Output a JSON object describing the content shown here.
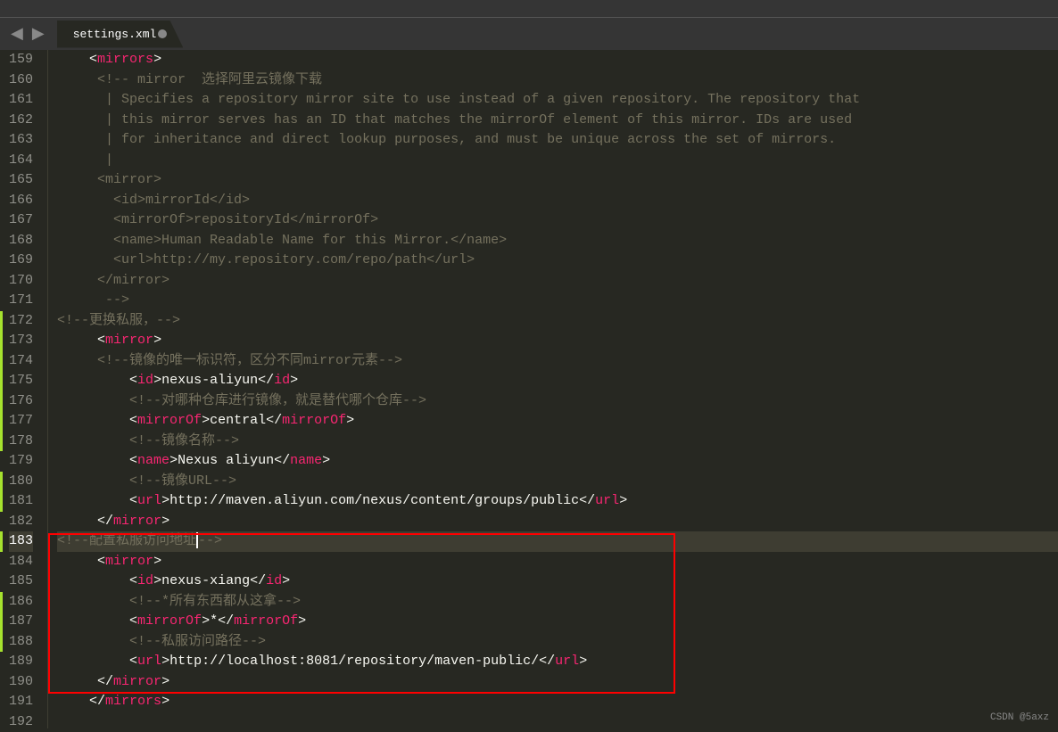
{
  "tab": {
    "label": "settings.xml"
  },
  "watermark": "CSDN @5axz",
  "lines": [
    {
      "n": 159,
      "indent": "    ",
      "parts": [
        {
          "t": "<",
          "c": "punct"
        },
        {
          "t": "mirrors",
          "c": "tag"
        },
        {
          "t": ">",
          "c": "punct"
        }
      ]
    },
    {
      "n": 160,
      "indent": "     ",
      "parts": [
        {
          "t": "<!-- mirror  选择阿里云镜像下载",
          "c": "comment"
        }
      ]
    },
    {
      "n": 161,
      "indent": "      ",
      "parts": [
        {
          "t": "| Specifies a repository mirror site to use instead of a given repository. The repository that",
          "c": "comment"
        }
      ]
    },
    {
      "n": 162,
      "indent": "      ",
      "parts": [
        {
          "t": "| this mirror serves has an ID that matches the mirrorOf element of this mirror. IDs are used",
          "c": "comment"
        }
      ]
    },
    {
      "n": 163,
      "indent": "      ",
      "parts": [
        {
          "t": "| for inheritance and direct lookup purposes, and must be unique across the set of mirrors.",
          "c": "comment"
        }
      ]
    },
    {
      "n": 164,
      "indent": "      ",
      "parts": [
        {
          "t": "|",
          "c": "comment"
        }
      ]
    },
    {
      "n": 165,
      "indent": "     ",
      "parts": [
        {
          "t": "<mirror>",
          "c": "comment"
        }
      ]
    },
    {
      "n": 166,
      "indent": "       ",
      "parts": [
        {
          "t": "<id>mirrorId</id>",
          "c": "comment"
        }
      ]
    },
    {
      "n": 167,
      "indent": "       ",
      "parts": [
        {
          "t": "<mirrorOf>repositoryId</mirrorOf>",
          "c": "comment"
        }
      ]
    },
    {
      "n": 168,
      "indent": "       ",
      "parts": [
        {
          "t": "<name>Human Readable Name for this Mirror.</name>",
          "c": "comment"
        }
      ]
    },
    {
      "n": 169,
      "indent": "       ",
      "parts": [
        {
          "t": "<url>http://my.repository.com/repo/path</url>",
          "c": "comment"
        }
      ]
    },
    {
      "n": 170,
      "indent": "     ",
      "parts": [
        {
          "t": "</mirror>",
          "c": "comment"
        }
      ]
    },
    {
      "n": 171,
      "indent": "      ",
      "parts": [
        {
          "t": "-->",
          "c": "comment"
        }
      ]
    },
    {
      "n": 172,
      "indent": "",
      "parts": [
        {
          "t": "<!--更换私服，-->",
          "c": "comment"
        }
      ]
    },
    {
      "n": 173,
      "indent": "     ",
      "parts": [
        {
          "t": "<",
          "c": "punct"
        },
        {
          "t": "mirror",
          "c": "tag"
        },
        {
          "t": ">",
          "c": "punct"
        }
      ]
    },
    {
      "n": 174,
      "indent": "     ",
      "parts": [
        {
          "t": "<!--镜像的唯一标识符，区分不同mirror元素-->",
          "c": "comment"
        }
      ]
    },
    {
      "n": 175,
      "indent": "         ",
      "parts": [
        {
          "t": "<",
          "c": "punct"
        },
        {
          "t": "id",
          "c": "tag"
        },
        {
          "t": ">",
          "c": "punct"
        },
        {
          "t": "nexus-aliyun",
          "c": "text"
        },
        {
          "t": "</",
          "c": "punct"
        },
        {
          "t": "id",
          "c": "tag"
        },
        {
          "t": ">",
          "c": "punct"
        }
      ]
    },
    {
      "n": 176,
      "indent": "         ",
      "parts": [
        {
          "t": "<!--对哪种仓库进行镜像，就是替代哪个仓库-->",
          "c": "comment"
        }
      ]
    },
    {
      "n": 177,
      "indent": "         ",
      "parts": [
        {
          "t": "<",
          "c": "punct"
        },
        {
          "t": "mirrorOf",
          "c": "tag"
        },
        {
          "t": ">",
          "c": "punct"
        },
        {
          "t": "central",
          "c": "text"
        },
        {
          "t": "</",
          "c": "punct"
        },
        {
          "t": "mirrorOf",
          "c": "tag"
        },
        {
          "t": ">",
          "c": "punct"
        }
      ]
    },
    {
      "n": 178,
      "indent": "         ",
      "parts": [
        {
          "t": "<!--镜像名称-->",
          "c": "comment"
        }
      ]
    },
    {
      "n": 179,
      "indent": "         ",
      "parts": [
        {
          "t": "<",
          "c": "punct"
        },
        {
          "t": "name",
          "c": "tag"
        },
        {
          "t": ">",
          "c": "punct"
        },
        {
          "t": "Nexus aliyun",
          "c": "text"
        },
        {
          "t": "</",
          "c": "punct"
        },
        {
          "t": "name",
          "c": "tag"
        },
        {
          "t": ">",
          "c": "punct"
        }
      ]
    },
    {
      "n": 180,
      "indent": "         ",
      "parts": [
        {
          "t": "<!--镜像URL-->",
          "c": "comment"
        }
      ]
    },
    {
      "n": 181,
      "indent": "         ",
      "parts": [
        {
          "t": "<",
          "c": "punct"
        },
        {
          "t": "url",
          "c": "tag"
        },
        {
          "t": ">",
          "c": "punct"
        },
        {
          "t": "http://maven.aliyun.com/nexus/content/groups/public",
          "c": "text"
        },
        {
          "t": "</",
          "c": "punct"
        },
        {
          "t": "url",
          "c": "tag"
        },
        {
          "t": ">",
          "c": "punct"
        }
      ]
    },
    {
      "n": 182,
      "indent": "     ",
      "parts": [
        {
          "t": "</",
          "c": "punct"
        },
        {
          "t": "mirror",
          "c": "tag"
        },
        {
          "t": ">",
          "c": "punct"
        }
      ]
    },
    {
      "n": 183,
      "indent": "",
      "current": true,
      "parts": [
        {
          "t": "<!--配置私服访问地址",
          "c": "comment"
        },
        {
          "t": "CURSOR",
          "c": "cursor"
        },
        {
          "t": "-->",
          "c": "comment"
        }
      ]
    },
    {
      "n": 184,
      "indent": "     ",
      "parts": [
        {
          "t": "<",
          "c": "punct"
        },
        {
          "t": "mirror",
          "c": "tag"
        },
        {
          "t": ">",
          "c": "punct"
        }
      ]
    },
    {
      "n": 185,
      "indent": "         ",
      "parts": [
        {
          "t": "<",
          "c": "punct"
        },
        {
          "t": "id",
          "c": "tag"
        },
        {
          "t": ">",
          "c": "punct"
        },
        {
          "t": "nexus-xiang",
          "c": "text"
        },
        {
          "t": "</",
          "c": "punct"
        },
        {
          "t": "id",
          "c": "tag"
        },
        {
          "t": ">",
          "c": "punct"
        }
      ]
    },
    {
      "n": 186,
      "indent": "         ",
      "parts": [
        {
          "t": "<!--*所有东西都从这拿-->",
          "c": "comment"
        }
      ]
    },
    {
      "n": 187,
      "indent": "         ",
      "parts": [
        {
          "t": "<",
          "c": "punct"
        },
        {
          "t": "mirrorOf",
          "c": "tag"
        },
        {
          "t": ">",
          "c": "punct"
        },
        {
          "t": "*",
          "c": "text"
        },
        {
          "t": "</",
          "c": "punct"
        },
        {
          "t": "mirrorOf",
          "c": "tag"
        },
        {
          "t": ">",
          "c": "punct"
        }
      ]
    },
    {
      "n": 188,
      "indent": "         ",
      "parts": [
        {
          "t": "<!--私服访问路径-->",
          "c": "comment"
        }
      ]
    },
    {
      "n": 189,
      "indent": "         ",
      "parts": [
        {
          "t": "<",
          "c": "punct"
        },
        {
          "t": "url",
          "c": "tag"
        },
        {
          "t": ">",
          "c": "punct"
        },
        {
          "t": "http://localhost:8081/repository/maven-public/",
          "c": "text"
        },
        {
          "t": "</",
          "c": "punct"
        },
        {
          "t": "url",
          "c": "tag"
        },
        {
          "t": ">",
          "c": "punct"
        }
      ]
    },
    {
      "n": 190,
      "indent": "     ",
      "parts": [
        {
          "t": "</",
          "c": "punct"
        },
        {
          "t": "mirror",
          "c": "tag"
        },
        {
          "t": ">",
          "c": "punct"
        }
      ]
    },
    {
      "n": 191,
      "indent": "    ",
      "parts": [
        {
          "t": "</",
          "c": "punct"
        },
        {
          "t": "mirrors",
          "c": "tag"
        },
        {
          "t": ">",
          "c": "punct"
        }
      ]
    },
    {
      "n": 192,
      "indent": "",
      "parts": []
    }
  ],
  "marks": [
    172,
    173,
    174,
    175,
    176,
    177,
    178,
    180,
    181,
    183,
    186,
    187,
    188
  ]
}
